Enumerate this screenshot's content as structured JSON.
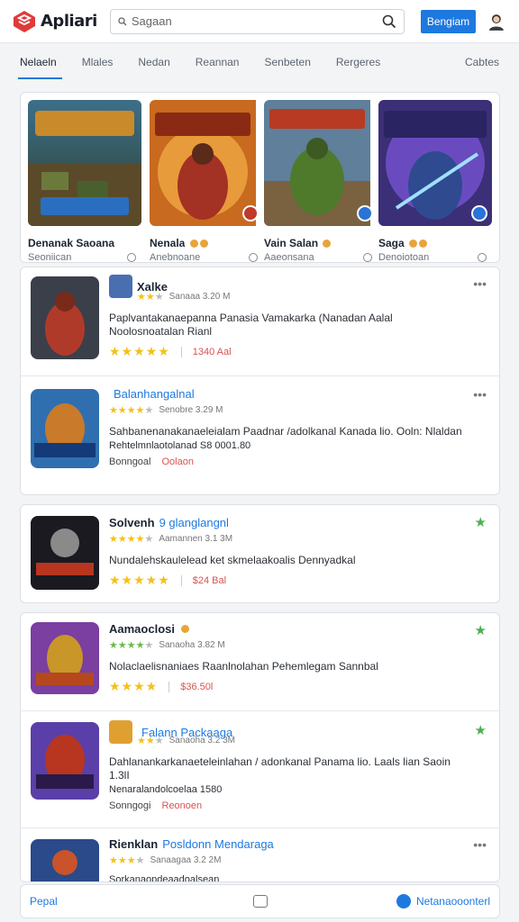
{
  "header": {
    "logo_text": "Apliari",
    "search_placeholder": "Sagaan",
    "signin_label": "Bengiam"
  },
  "tabs": [
    {
      "label": "Nelaeln",
      "active": true
    },
    {
      "label": "Mlales"
    },
    {
      "label": "Nedan"
    },
    {
      "label": "Reannan"
    },
    {
      "label": "Senbeten"
    },
    {
      "label": "Rergeres"
    },
    {
      "label": "Cabtes"
    }
  ],
  "featured": [
    {
      "title": "Denanak Saoana",
      "sub": "Seoniican"
    },
    {
      "title": "Nenala",
      "sub": "Anebnoane"
    },
    {
      "title": "Vain Salan",
      "sub": "Aaeonsana"
    },
    {
      "title": "Saga",
      "sub": "Denoiotoan"
    }
  ],
  "list": [
    {
      "name": "Xalke",
      "name_accent": "",
      "rating_text": "Sanaaa 3.20 M",
      "desc": "Paplvantakanaepanna Panasia Vamakarka (Nanadan Aalal Noolosnoatalan Rianl",
      "price": "1340 Aal",
      "action": "more"
    },
    {
      "name": "",
      "name_accent": "Balanhangalnal",
      "rating_text": "Senobre 3.29 M",
      "desc": "Sahbanenanakanaeleialam Paadnar /adolkanal Kanada lio. Ooln: Nlaldan",
      "desc2": "Rehtelmnlaotolanad   S8 0001.80",
      "tag": "Bonngoal",
      "price": "Oolaon",
      "action": "more"
    },
    {
      "name": "Solvenh",
      "name_accent": "9 glanglangnl",
      "rating_text": "Aamannen 3.1 3M",
      "desc": "Nundalehskaulelead ket skmelaakoalis Dennyadkal",
      "price": "$24 Bal",
      "action": "star"
    },
    {
      "name": "Aamaoclosi",
      "name_accent": "",
      "rating_text": "Sanaoha 3.82 M",
      "desc": "Nolaclaelisnaniaes Raanlnolahan Pehemlegam Sannbal",
      "price": "$36.50l",
      "action": "star"
    },
    {
      "name": "",
      "name_accent": "Falann Packaaga",
      "rating_text": "Sanaoha 3.2 3M",
      "desc": "Dahlanankarkanaeteleinlahan / adonkanal Panama lio. Laals lian Saoin 1.3lI",
      "desc2": "Nenaralandolcoelaa 1580",
      "tag": "Sonngogi",
      "price": "Reonoen",
      "action": "star"
    },
    {
      "name": "Rienklan",
      "name_accent": "Posldonn Mendaraga",
      "rating_text": "Sanaagaa 3.2 2M",
      "desc": "Sorkanaopdeaadoalsean",
      "price": "",
      "action": "more"
    }
  ],
  "bottom": {
    "left_label": "Pepal",
    "right_label": "Netanaooonterl"
  },
  "colors": {
    "accent": "#1d79e0",
    "star": "#f3c11a",
    "price": "#d9534f",
    "fav": "#4caf50"
  }
}
